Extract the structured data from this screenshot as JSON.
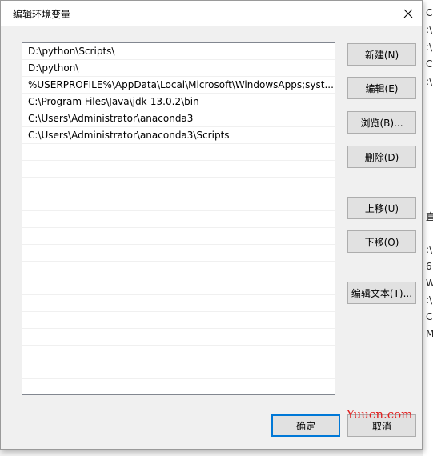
{
  "background": {
    "edge_chars": [
      "C",
      ":\\",
      ":\\",
      "C",
      ":\\",
      "直",
      ":\\",
      "6",
      "Wi",
      ":\\",
      "C",
      "M"
    ]
  },
  "dialog": {
    "title": "编辑环境变量",
    "close_glyph": "✕",
    "paths": [
      "D:\\python\\Scripts\\",
      "D:\\python\\",
      "%USERPROFILE%\\AppData\\Local\\Microsoft\\WindowsApps;syst...",
      "C:\\Program Files\\Java\\jdk-13.0.2\\bin",
      "C:\\Users\\Administrator\\anaconda3",
      "C:\\Users\\Administrator\\anaconda3\\Scripts",
      "",
      "",
      "",
      "",
      "",
      "",
      "",
      "",
      "",
      "",
      "",
      "",
      "",
      "",
      ""
    ],
    "buttons": {
      "new": "新建(N)",
      "edit": "编辑(E)",
      "browse": "浏览(B)...",
      "delete": "删除(D)",
      "move_up": "上移(U)",
      "move_down": "下移(O)",
      "edit_text": "编辑文本(T)...",
      "ok": "确定",
      "cancel": "取消"
    }
  },
  "watermark": "Yuucn.com",
  "colors": {
    "default_button_border": "#0078d7",
    "watermark": "#e02020"
  }
}
